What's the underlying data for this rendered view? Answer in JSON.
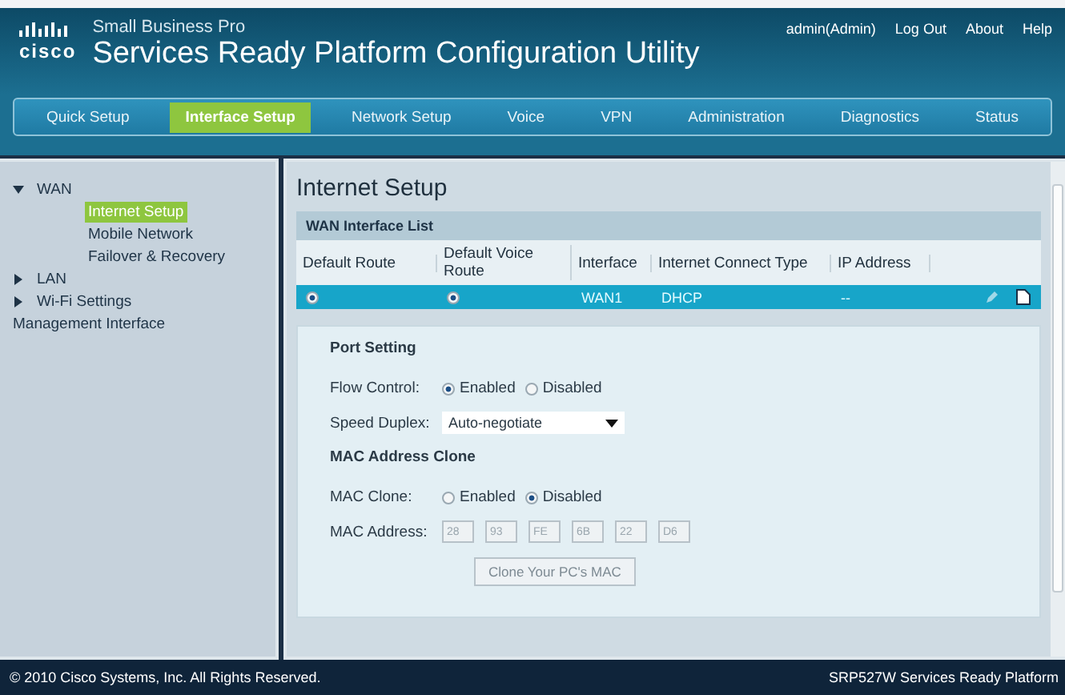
{
  "header": {
    "logo_text": "cisco",
    "subtitle": "Small Business Pro",
    "title": "Services Ready Platform Configuration Utility",
    "links": [
      "admin(Admin)",
      "Log Out",
      "About",
      "Help"
    ]
  },
  "nav": [
    {
      "label": "Quick Setup",
      "selected": false
    },
    {
      "label": "Interface Setup",
      "selected": true
    },
    {
      "label": "Network Setup",
      "selected": false
    },
    {
      "label": "Voice",
      "selected": false
    },
    {
      "label": "VPN",
      "selected": false
    },
    {
      "label": "Administration",
      "selected": false
    },
    {
      "label": "Diagnostics",
      "selected": false
    },
    {
      "label": "Status",
      "selected": false
    }
  ],
  "sidebar": {
    "items": [
      {
        "label": "WAN",
        "kind": "folder",
        "expanded": true,
        "children": [
          {
            "label": "Internet Setup",
            "selected": true
          },
          {
            "label": "Mobile Network",
            "selected": false
          },
          {
            "label": "Failover & Recovery",
            "selected": false
          }
        ]
      },
      {
        "label": "LAN",
        "kind": "folder",
        "expanded": false
      },
      {
        "label": "Wi-Fi Settings",
        "kind": "folder",
        "expanded": false
      },
      {
        "label": "Management Interface",
        "kind": "leaf"
      }
    ]
  },
  "page": {
    "title": "Internet Setup",
    "wan_list": {
      "title": "WAN Interface List",
      "columns": [
        "Default Route",
        "Default Voice Route",
        "Interface",
        "Internet Connect Type",
        "IP Address"
      ],
      "rows": [
        {
          "default_route": true,
          "default_voice_route": true,
          "interface": "WAN1",
          "connect_type": "DHCP",
          "ip_address": "--",
          "selected": true
        }
      ]
    },
    "port_setting": {
      "title": "Port Setting",
      "flow_control": {
        "label": "Flow Control:",
        "options": [
          {
            "label": "Enabled",
            "selected": true
          },
          {
            "label": "Disabled",
            "selected": false
          }
        ]
      },
      "speed_duplex": {
        "label": "Speed Duplex:",
        "value": "Auto-negotiate"
      },
      "mac_title": "MAC Address Clone",
      "mac_clone": {
        "label": "MAC Clone:",
        "options": [
          {
            "label": "Enabled",
            "selected": false
          },
          {
            "label": "Disabled",
            "selected": true
          }
        ]
      },
      "mac_address": {
        "label": "MAC Address:",
        "octets": [
          "28",
          "93",
          "FE",
          "6B",
          "22",
          "D6"
        ]
      },
      "clone_button": {
        "label": "Clone Your PC's MAC",
        "disabled": true
      }
    }
  },
  "footer": {
    "copyright": "© 2010 Cisco Systems, Inc. All Rights Reserved.",
    "product": "SRP527W Services Ready Platform"
  }
}
